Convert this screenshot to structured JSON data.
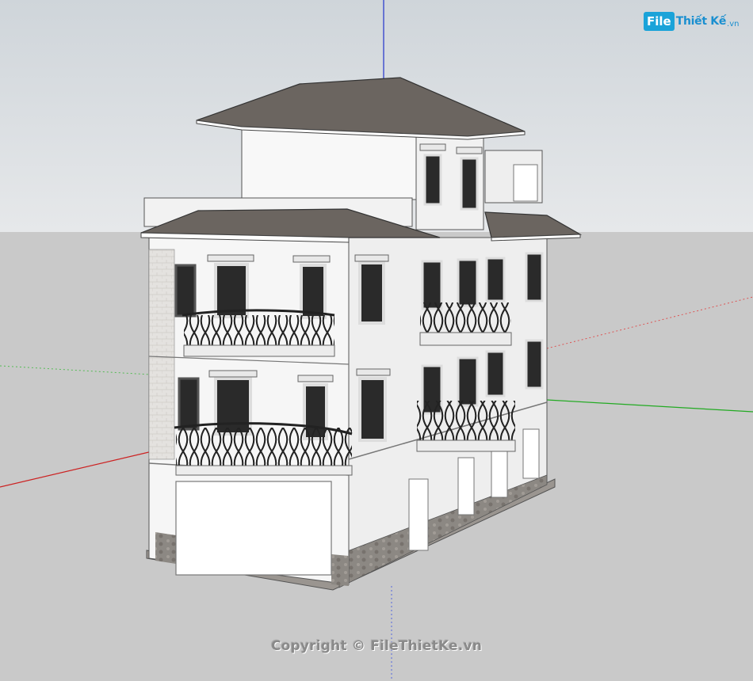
{
  "watermark": {
    "logo_box": "File",
    "logo_name": "Thiết Kế",
    "logo_tld": ".vn",
    "copyright": "Copyright © FileThietKe.vn"
  },
  "scene": {
    "sky_color": "#dfe3e6",
    "ground_color": "#c8c8c8",
    "axis_red": "#cc2222",
    "axis_green": "#22aa22",
    "axis_blue": "#2233cc",
    "wall_color": "#f4f4f4",
    "roof_color": "#6b6560",
    "stone_color": "#8a8580",
    "railing_color": "#222222"
  }
}
